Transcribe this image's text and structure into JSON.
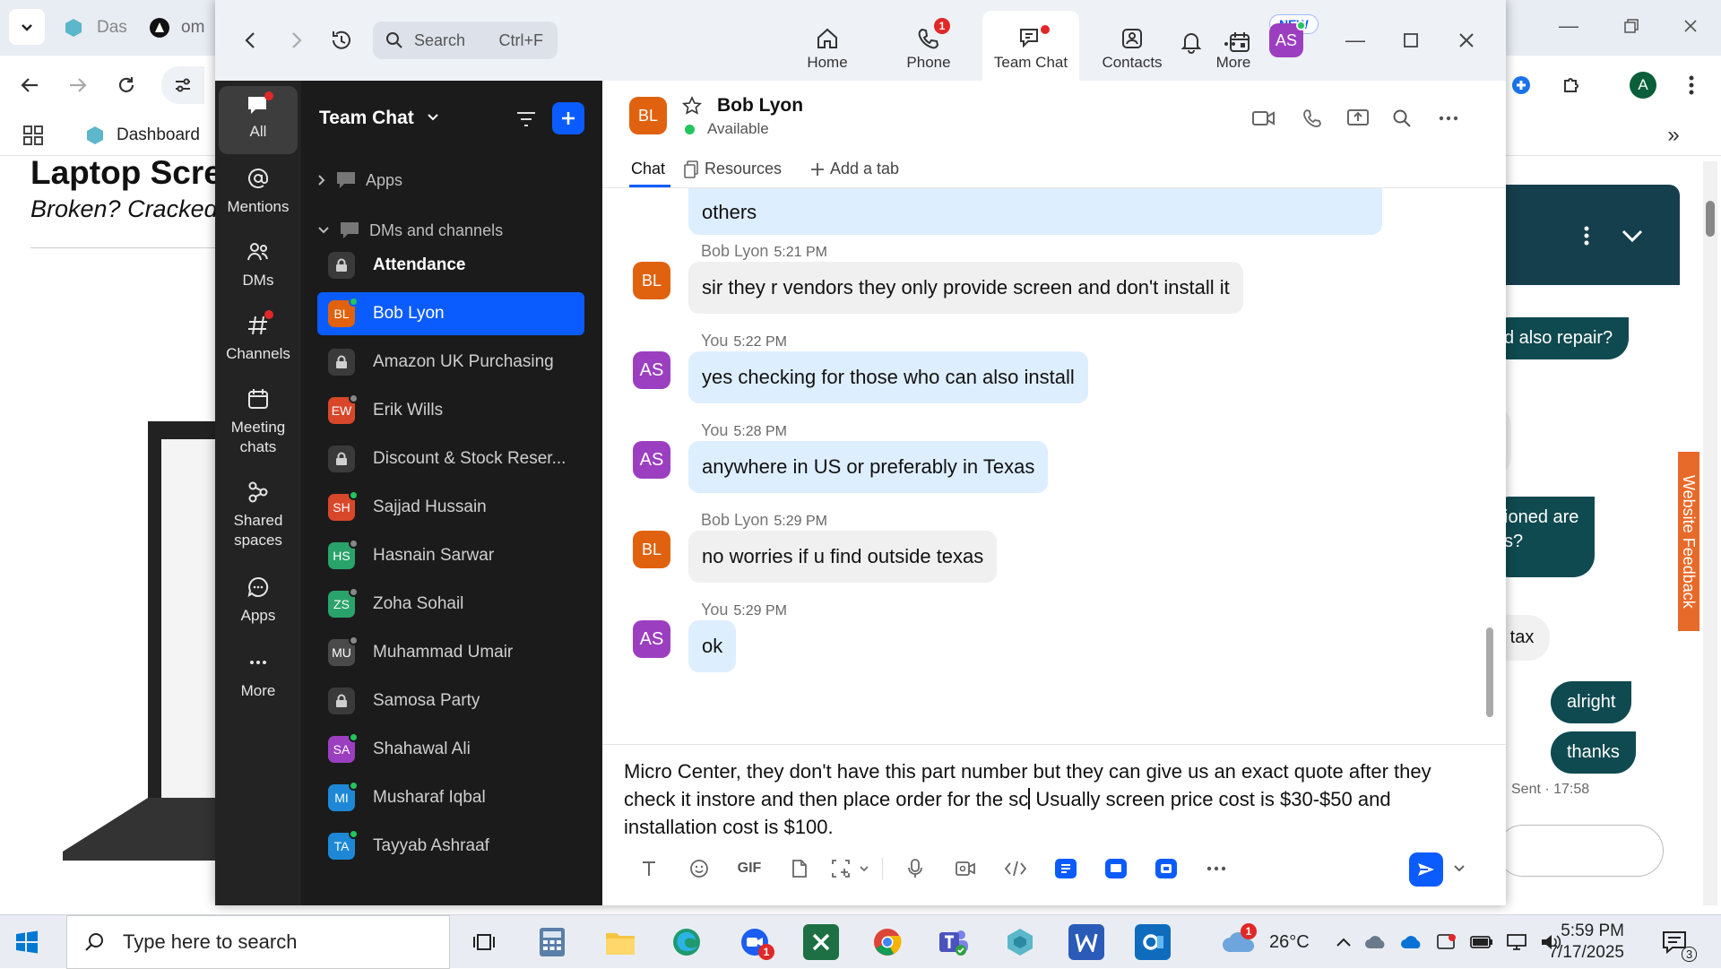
{
  "browser": {
    "tabs": [
      {
        "label": "Das"
      },
      {
        "label": "om"
      }
    ],
    "bookmarks": {
      "apps_label": "Apps",
      "dashboard": "Dashboard"
    },
    "profile_letter": "A",
    "page": {
      "title": "Laptop Scre",
      "subtitle": "Broken? Cracked"
    },
    "widget": {
      "bubbles": [
        "d also repair?",
        "ioned are",
        "s?",
        "alright",
        "thanks"
      ],
      "grey": [
        "y",
        "e tax"
      ],
      "sent": "Sent · 17:58"
    },
    "feedback_label": "Website Feedback"
  },
  "zoom": {
    "search": {
      "placeholder": "Search",
      "shortcut": "Ctrl+F"
    },
    "tabs": [
      {
        "label": "Home"
      },
      {
        "label": "Phone",
        "badge": "1"
      },
      {
        "label": "Team Chat"
      },
      {
        "label": "Contacts"
      },
      {
        "label": "More",
        "badge": "NEW"
      }
    ],
    "user_initials": "AS",
    "rail": [
      {
        "label": "All"
      },
      {
        "label": "Mentions"
      },
      {
        "label": "DMs"
      },
      {
        "label": "Channels"
      },
      {
        "label": "Meeting chats"
      },
      {
        "label": "Shared spaces"
      },
      {
        "label": "Apps"
      },
      {
        "label": "More"
      }
    ],
    "channels": {
      "title": "Team Chat",
      "apps_section": "Apps",
      "dm_section": "DMs and channels",
      "items": [
        {
          "name": "Attendance",
          "type": "lock",
          "bold": true
        },
        {
          "name": "Bob Lyon",
          "type": "person",
          "initials": "BL",
          "color": "#e0620e",
          "status": "#22c55e",
          "selected": true
        },
        {
          "name": "Amazon UK Purchasing",
          "type": "lock"
        },
        {
          "name": "Erik Wills",
          "type": "person",
          "initials": "EW",
          "color": "#d9472b",
          "status": "#888888"
        },
        {
          "name": "Discount & Stock Reser...",
          "type": "lock"
        },
        {
          "name": "Sajjad Hussain",
          "type": "person",
          "initials": "SH",
          "color": "#d9472b",
          "status": "#22c55e"
        },
        {
          "name": "Hasnain Sarwar",
          "type": "person",
          "initials": "HS",
          "color": "#2aa36b",
          "status": "#888888"
        },
        {
          "name": "Zoha Sohail",
          "type": "person",
          "initials": "ZS",
          "color": "#2aa36b",
          "status": "#888888"
        },
        {
          "name": "Muhammad Umair",
          "type": "person",
          "initials": "MU",
          "color": "#4a4a4a",
          "status": "#888888"
        },
        {
          "name": "Samosa Party",
          "type": "lock"
        },
        {
          "name": "Shahawal Ali",
          "type": "person",
          "initials": "SA",
          "color": "#9b3fc0",
          "status": "#22c55e"
        },
        {
          "name": "Musharaf Iqbal",
          "type": "person",
          "initials": "MI",
          "color": "#1e88d6",
          "status": "#22c55e"
        },
        {
          "name": "Tayyab Ashraaf",
          "type": "person",
          "initials": "TA",
          "color": "#1e88d6",
          "status": "#22c55e"
        }
      ]
    },
    "chat": {
      "contact": {
        "name": "Bob Lyon",
        "initials": "BL",
        "status": "Available"
      },
      "subtabs": {
        "chat": "Chat",
        "resources": "Resources",
        "add": "Add a tab"
      },
      "partial_message": "others",
      "messages": [
        {
          "sender": "Bob Lyon",
          "time": "5:21 PM",
          "initials": "BL",
          "mine": false,
          "text": "sir they r vendors they only provide screen and don't install it"
        },
        {
          "sender": "You",
          "time": "5:22 PM",
          "initials": "AS",
          "mine": true,
          "text": "yes checking for those who can also install"
        },
        {
          "sender": "You",
          "time": "5:28 PM",
          "initials": "AS",
          "mine": true,
          "text": "anywhere in US or preferably in Texas"
        },
        {
          "sender": "Bob Lyon",
          "time": "5:29 PM",
          "initials": "BL",
          "mine": false,
          "text": "no worries if u find outside texas"
        },
        {
          "sender": "You",
          "time": "5:29 PM",
          "initials": "AS",
          "mine": true,
          "text": "ok"
        }
      ],
      "compose": {
        "before_caret": "Micro Center, they don't have this part number but they can give us an exact quote after they check it instore and then place order for the sc",
        "after_caret": " Usually screen price cost is $30-$50 and installation cost is $100.",
        "gif_label": "GIF"
      }
    }
  },
  "taskbar": {
    "search_placeholder": "Type here to search",
    "weather": "26°C",
    "time": "5:59 PM",
    "date": "7/17/2025",
    "notif_count": "3",
    "zoom_badge": "1",
    "weather_badge": "1"
  }
}
